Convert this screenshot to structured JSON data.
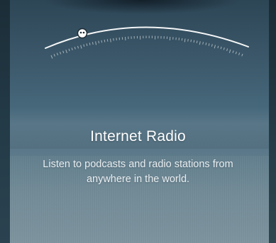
{
  "card": {
    "title": "Internet Radio",
    "description": "Listen to podcasts and radio stations from anywhere in the world."
  },
  "icons": {
    "dial": "radio-tuner-dial-icon",
    "knob": "tuner-knob-icon"
  },
  "colors": {
    "text_primary": "#ffffff",
    "text_secondary": "#e8eef1",
    "background": "#4a6a7d"
  }
}
